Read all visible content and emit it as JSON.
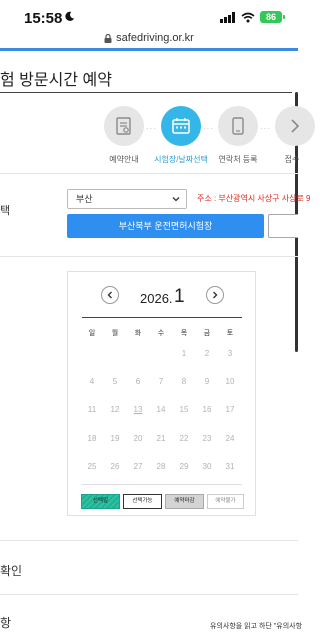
{
  "status_bar": {
    "time": "15:58",
    "battery": "86"
  },
  "browser": {
    "url": "safedriving.or.kr"
  },
  "page": {
    "title": "험 방문시간 예약"
  },
  "steps": [
    {
      "label": "예약안내",
      "active": false,
      "icon": "document-icon"
    },
    {
      "label": "시험장/날짜선택",
      "active": true,
      "icon": "calendar-icon"
    },
    {
      "label": "연락처 등록",
      "active": false,
      "icon": "phone-icon"
    },
    {
      "label": "접수",
      "active": false,
      "icon": "chevron-right-icon"
    }
  ],
  "selection": {
    "side_label": "택",
    "region_value": "부산",
    "address": "주소 : 부산광역시 사상구 사상로 9",
    "center_button": "부산북부 운전면허시험장"
  },
  "calendar": {
    "year": "2026.",
    "month": "1",
    "weekdays": [
      "일",
      "월",
      "화",
      "수",
      "목",
      "금",
      "토"
    ],
    "weeks": [
      [
        "",
        "",
        "",
        "",
        "1",
        "2",
        "3"
      ],
      [
        "4",
        "5",
        "6",
        "7",
        "8",
        "9",
        "10"
      ],
      [
        "11",
        "12",
        "13",
        "14",
        "15",
        "16",
        "17"
      ],
      [
        "18",
        "19",
        "20",
        "21",
        "22",
        "23",
        "24"
      ],
      [
        "25",
        "26",
        "27",
        "28",
        "29",
        "30",
        "31"
      ]
    ],
    "legend": {
      "selected": "선택일",
      "available": "선택가능",
      "closed": "예약마감",
      "unavailable": "예약불가"
    }
  },
  "sections": {
    "confirm_label": "확인",
    "notice_label": "항",
    "notice_text": "유의사항을 읽고 하단 \"유의사항"
  },
  "colors": {
    "accent": "#35b6e8",
    "button": "#2f8ff0",
    "address": "#e0261d",
    "selected_legend": "#2cc3a4"
  }
}
